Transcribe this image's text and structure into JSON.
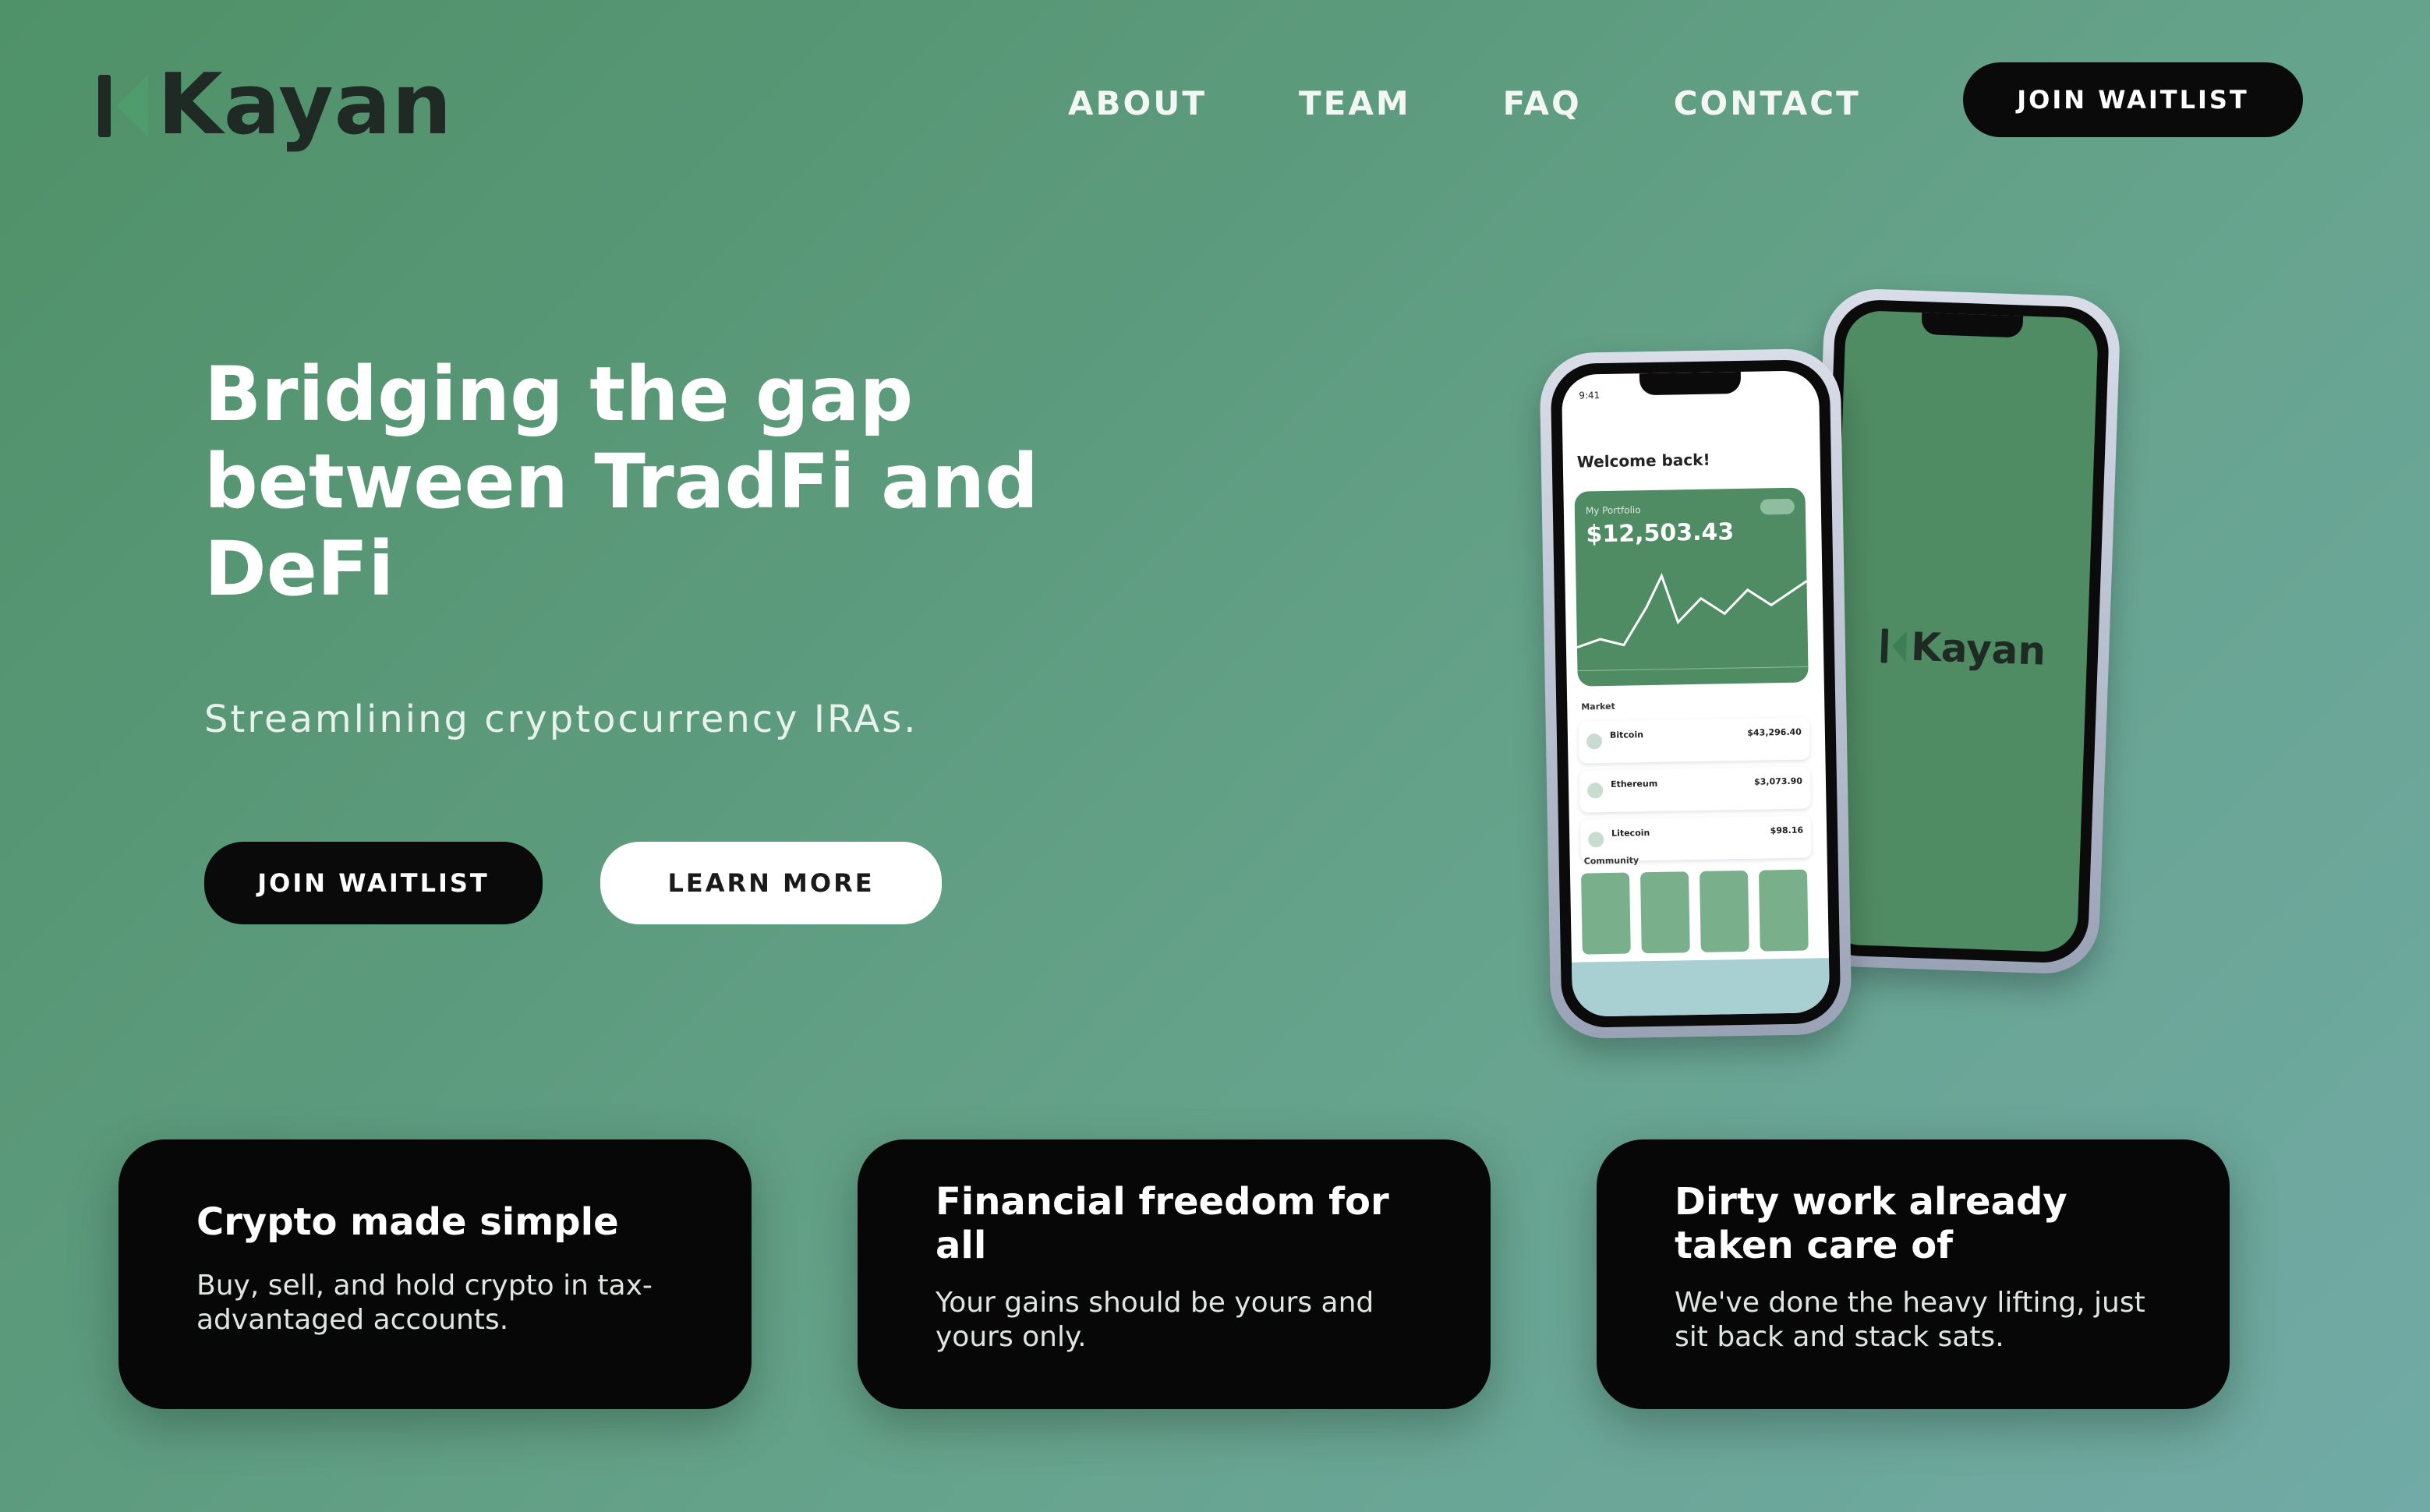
{
  "brand": {
    "name": "Kayan",
    "colors": {
      "dark": "#1f2a24",
      "accent": "#4f9d6c",
      "button_dark": "#0a0a0a",
      "card_bg": "#070707"
    }
  },
  "nav": {
    "items": [
      {
        "label": "ABOUT"
      },
      {
        "label": "TEAM"
      },
      {
        "label": "FAQ"
      },
      {
        "label": "CONTACT"
      }
    ],
    "cta_label": "JOIN WAITLIST"
  },
  "hero": {
    "title": "Bridging the gap between TradFi and DeFi",
    "subtitle": "Streamlining cryptocurrency IRAs.",
    "primary_button": "JOIN WAITLIST",
    "secondary_button": "LEARN MORE"
  },
  "phone_app": {
    "time": "9:41",
    "welcome": "Welcome back!",
    "portfolio_label": "My Portfolio",
    "portfolio_value": "$12,503.43",
    "market_label": "Market",
    "assets": [
      {
        "name": "Bitcoin",
        "price": "$43,296.40"
      },
      {
        "name": "Ethereum",
        "price": "$3,073.90"
      },
      {
        "name": "Litecoin",
        "price": "$98.16"
      }
    ],
    "section_label": "Community",
    "back_logo": "Kayan"
  },
  "features": [
    {
      "title": "Crypto made simple",
      "body": "Buy, sell, and hold crypto in tax-advantaged accounts."
    },
    {
      "title": "Financial freedom for all",
      "body": "Your gains should be yours and yours only."
    },
    {
      "title": "Dirty work already taken care of",
      "body": "We've done the heavy lifting, just sit back and stack sats."
    }
  ]
}
